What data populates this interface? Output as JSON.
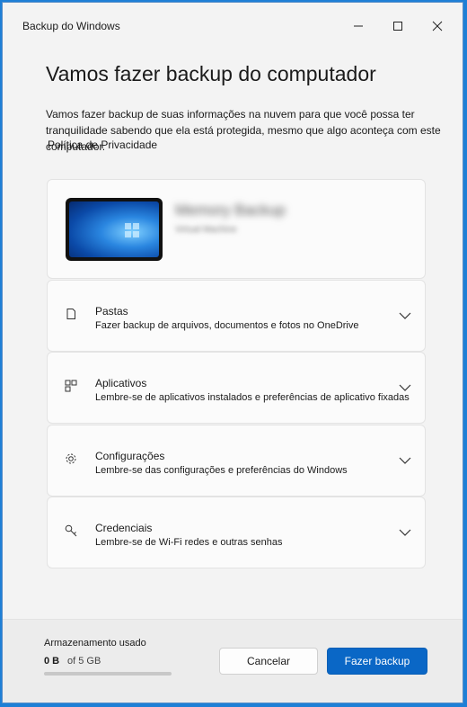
{
  "window": {
    "title": "Backup do Windows"
  },
  "main": {
    "heading": "Vamos fazer backup do computador",
    "intro": "Vamos fazer backup de suas informações na nuvem para que você possa ter tranquilidade sabendo que ela está protegida, mesmo que algo aconteça com este computador.",
    "privacy_link": "Política de Privacidade"
  },
  "device": {
    "name": "Memory Backup",
    "subtitle": "Virtual Machine"
  },
  "items": [
    {
      "label": "Pastas",
      "description": "Fazer backup de arquivos, documentos e fotos no OneDrive",
      "icon": "folder-icon"
    },
    {
      "label": "Aplicativos",
      "description": "Lembre-se de aplicativos instalados e preferências de aplicativo fixadas",
      "icon": "apps-icon"
    },
    {
      "label": "Configurações",
      "description": "Lembre-se das configurações e preferências do Windows",
      "icon": "gear-icon"
    },
    {
      "label": "Credenciais",
      "description": "Lembre-se de Wi-Fi redes e outras senhas",
      "icon": "key-icon"
    }
  ],
  "footer": {
    "storage_label": "Armazenamento usado",
    "storage_used": "0 B",
    "storage_total": "of 5 GB",
    "storage_fraction": 0,
    "cancel_label": "Cancelar",
    "backup_label": "Fazer backup"
  },
  "colors": {
    "accent": "#0a67c6",
    "desktop": "#1e7fd6"
  }
}
